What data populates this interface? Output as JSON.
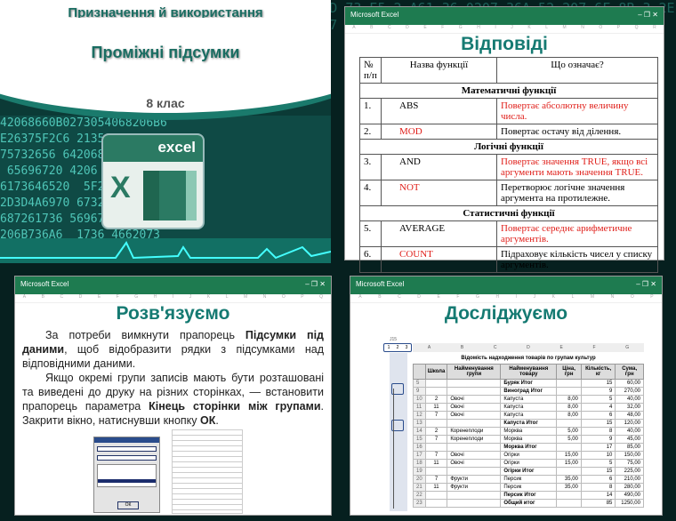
{
  "slide1": {
    "title_top": "Призначення й використання",
    "title": "Проміжні підсумки",
    "grade": "8 клас",
    "logo_text": "excel"
  },
  "window_title": "Microsoft Excel",
  "window_controls": [
    "–",
    "❐",
    "✕"
  ],
  "slide2": {
    "title": "Відповіді",
    "headers": [
      "№ п/п",
      "Назва функції",
      "Що означає?"
    ],
    "sections": [
      {
        "name": "Математичні функції",
        "rows": [
          [
            "1.",
            "ABS",
            "Повертає абсолютну величину числа."
          ],
          [
            "2.",
            "MOD",
            "Повертає остачу від ділення."
          ]
        ]
      },
      {
        "name": "Логічні функції",
        "rows": [
          [
            "3.",
            "AND",
            "Повертає значення TRUE, якщо всі аргументи мають значення TRUE."
          ],
          [
            "4.",
            "NOT",
            "Перетворює логічне значення аргумента на протилежне."
          ]
        ]
      },
      {
        "name": "Статистичні функції",
        "rows": [
          [
            "5.",
            "AVERAGE",
            "Повертає середнє арифметичне аргументів."
          ],
          [
            "6.",
            "COUNT",
            "Підраховує кількість чисел у списку аргументів."
          ]
        ]
      }
    ]
  },
  "slide3": {
    "title": "Розв'язуємо",
    "p1": [
      "За потреби вимкнути прапорець ",
      "Підсумки під даними",
      ", щоб відобразити рядки з підсумками над відповідними даними."
    ],
    "p2": [
      "Якщо окремі групи записів мають бути розташовані та виведені до друку на різних сторінках, — встановити прапорець параметра ",
      "Кінець сторінки між групами",
      ". Закрити вікно, натиснувши кнопку ",
      "ОК",
      "."
    ],
    "dialog_ok": "ОК"
  },
  "slide4": {
    "title": "Досліджуємо",
    "outline_levels": [
      "1",
      "2",
      "3"
    ],
    "cell_ref": "J15",
    "sheet_title": "Відомість надходження товарів по групам культур",
    "col_letters": [
      "A",
      "B",
      "C",
      "D",
      "E",
      "F",
      "G"
    ],
    "headers": [
      "Школа",
      "Найменування групи",
      "Найменування товару",
      "Ціна, грн",
      "Кількість, кг",
      "Сума, грн"
    ],
    "rows": [
      [
        "5",
        "",
        "",
        "Буряк Итог",
        "",
        "15",
        "60,00"
      ],
      [
        "9",
        "",
        "",
        "Виноград Итог",
        "",
        "9",
        "270,00"
      ],
      [
        "10",
        "2",
        "Овочі",
        "Капуста",
        "8,00",
        "5",
        "40,00"
      ],
      [
        "11",
        "11",
        "Овочі",
        "Капуста",
        "8,00",
        "4",
        "32,00"
      ],
      [
        "12",
        "7",
        "Овочі",
        "Капуста",
        "8,00",
        "6",
        "48,00"
      ],
      [
        "13",
        "",
        "",
        "Капуста Итог",
        "",
        "15",
        "120,00"
      ],
      [
        "14",
        "2",
        "Коренеплоди",
        "Морква",
        "5,00",
        "8",
        "40,00"
      ],
      [
        "15",
        "7",
        "Коренеплоди",
        "Морква",
        "5,00",
        "9",
        "45,00"
      ],
      [
        "16",
        "",
        "",
        "Морква Итог",
        "",
        "17",
        "85,00"
      ],
      [
        "17",
        "7",
        "Овочі",
        "Огірки",
        "15,00",
        "10",
        "150,00"
      ],
      [
        "18",
        "11",
        "Овочі",
        "Огірки",
        "15,00",
        "5",
        "75,00"
      ],
      [
        "19",
        "",
        "",
        "Огірки Итог",
        "",
        "15",
        "225,00"
      ],
      [
        "20",
        "7",
        "Фрукти",
        "Персик",
        "35,00",
        "6",
        "210,00"
      ],
      [
        "21",
        "11",
        "Фрукти",
        "Персик",
        "35,00",
        "8",
        "280,00"
      ],
      [
        "22",
        "",
        "",
        "Персик Итог",
        "",
        "14",
        "490,00"
      ],
      [
        "23",
        "",
        "",
        "Общий итог",
        "",
        "85",
        "1250,00"
      ]
    ]
  }
}
